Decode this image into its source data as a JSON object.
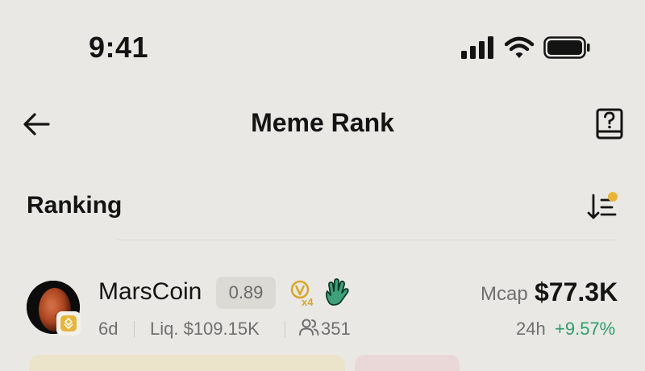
{
  "status_bar": {
    "time": "9:41",
    "icons": [
      "signal-icon",
      "wifi-icon",
      "battery-icon"
    ]
  },
  "header": {
    "title": "Meme Rank",
    "back_icon": "arrow-left-icon",
    "help_icon": "help-book-icon"
  },
  "section": {
    "title": "Ranking",
    "sort_icon": "sort-descending-icon",
    "sort_has_indicator": true
  },
  "tokens": [
    {
      "name": "MarsCoin",
      "score": "0.89",
      "boost_label": "x4",
      "age": "6d",
      "liquidity": "Liq. $109.15K",
      "holders": "351",
      "mcap_label": "Mcap",
      "mcap_value": "$77.3K",
      "change_period": "24h",
      "change_value": "+9.57%",
      "chain_badge_icon": "bnb-chain-icon",
      "hand_icon": "waving-hand-icon"
    }
  ],
  "colors": {
    "background": "#e9e8e4",
    "positive": "#2f9c6b",
    "accent": "#e8b53a",
    "muted_text": "#6f6f6f"
  }
}
